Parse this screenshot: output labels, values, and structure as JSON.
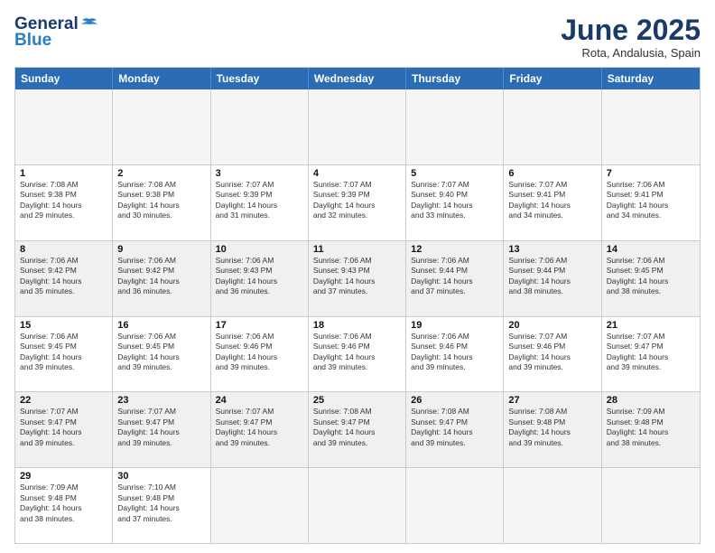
{
  "logo": {
    "line1": "General",
    "line2": "Blue"
  },
  "title": "June 2025",
  "subtitle": "Rota, Andalusia, Spain",
  "header_days": [
    "Sunday",
    "Monday",
    "Tuesday",
    "Wednesday",
    "Thursday",
    "Friday",
    "Saturday"
  ],
  "rows": [
    [
      {
        "day": "",
        "info": "",
        "empty": true
      },
      {
        "day": "",
        "info": "",
        "empty": true
      },
      {
        "day": "",
        "info": "",
        "empty": true
      },
      {
        "day": "",
        "info": "",
        "empty": true
      },
      {
        "day": "",
        "info": "",
        "empty": true
      },
      {
        "day": "",
        "info": "",
        "empty": true
      },
      {
        "day": "",
        "info": "",
        "empty": true
      }
    ],
    [
      {
        "day": "1",
        "info": "Sunrise: 7:08 AM\nSunset: 9:38 PM\nDaylight: 14 hours\nand 29 minutes."
      },
      {
        "day": "2",
        "info": "Sunrise: 7:08 AM\nSunset: 9:38 PM\nDaylight: 14 hours\nand 30 minutes."
      },
      {
        "day": "3",
        "info": "Sunrise: 7:07 AM\nSunset: 9:39 PM\nDaylight: 14 hours\nand 31 minutes."
      },
      {
        "day": "4",
        "info": "Sunrise: 7:07 AM\nSunset: 9:39 PM\nDaylight: 14 hours\nand 32 minutes."
      },
      {
        "day": "5",
        "info": "Sunrise: 7:07 AM\nSunset: 9:40 PM\nDaylight: 14 hours\nand 33 minutes."
      },
      {
        "day": "6",
        "info": "Sunrise: 7:07 AM\nSunset: 9:41 PM\nDaylight: 14 hours\nand 34 minutes."
      },
      {
        "day": "7",
        "info": "Sunrise: 7:06 AM\nSunset: 9:41 PM\nDaylight: 14 hours\nand 34 minutes."
      }
    ],
    [
      {
        "day": "8",
        "info": "Sunrise: 7:06 AM\nSunset: 9:42 PM\nDaylight: 14 hours\nand 35 minutes."
      },
      {
        "day": "9",
        "info": "Sunrise: 7:06 AM\nSunset: 9:42 PM\nDaylight: 14 hours\nand 36 minutes."
      },
      {
        "day": "10",
        "info": "Sunrise: 7:06 AM\nSunset: 9:43 PM\nDaylight: 14 hours\nand 36 minutes."
      },
      {
        "day": "11",
        "info": "Sunrise: 7:06 AM\nSunset: 9:43 PM\nDaylight: 14 hours\nand 37 minutes."
      },
      {
        "day": "12",
        "info": "Sunrise: 7:06 AM\nSunset: 9:44 PM\nDaylight: 14 hours\nand 37 minutes."
      },
      {
        "day": "13",
        "info": "Sunrise: 7:06 AM\nSunset: 9:44 PM\nDaylight: 14 hours\nand 38 minutes."
      },
      {
        "day": "14",
        "info": "Sunrise: 7:06 AM\nSunset: 9:45 PM\nDaylight: 14 hours\nand 38 minutes."
      }
    ],
    [
      {
        "day": "15",
        "info": "Sunrise: 7:06 AM\nSunset: 9:45 PM\nDaylight: 14 hours\nand 39 minutes."
      },
      {
        "day": "16",
        "info": "Sunrise: 7:06 AM\nSunset: 9:45 PM\nDaylight: 14 hours\nand 39 minutes."
      },
      {
        "day": "17",
        "info": "Sunrise: 7:06 AM\nSunset: 9:46 PM\nDaylight: 14 hours\nand 39 minutes."
      },
      {
        "day": "18",
        "info": "Sunrise: 7:06 AM\nSunset: 9:46 PM\nDaylight: 14 hours\nand 39 minutes."
      },
      {
        "day": "19",
        "info": "Sunrise: 7:06 AM\nSunset: 9:46 PM\nDaylight: 14 hours\nand 39 minutes."
      },
      {
        "day": "20",
        "info": "Sunrise: 7:07 AM\nSunset: 9:46 PM\nDaylight: 14 hours\nand 39 minutes."
      },
      {
        "day": "21",
        "info": "Sunrise: 7:07 AM\nSunset: 9:47 PM\nDaylight: 14 hours\nand 39 minutes."
      }
    ],
    [
      {
        "day": "22",
        "info": "Sunrise: 7:07 AM\nSunset: 9:47 PM\nDaylight: 14 hours\nand 39 minutes."
      },
      {
        "day": "23",
        "info": "Sunrise: 7:07 AM\nSunset: 9:47 PM\nDaylight: 14 hours\nand 39 minutes."
      },
      {
        "day": "24",
        "info": "Sunrise: 7:07 AM\nSunset: 9:47 PM\nDaylight: 14 hours\nand 39 minutes."
      },
      {
        "day": "25",
        "info": "Sunrise: 7:08 AM\nSunset: 9:47 PM\nDaylight: 14 hours\nand 39 minutes."
      },
      {
        "day": "26",
        "info": "Sunrise: 7:08 AM\nSunset: 9:47 PM\nDaylight: 14 hours\nand 39 minutes."
      },
      {
        "day": "27",
        "info": "Sunrise: 7:08 AM\nSunset: 9:48 PM\nDaylight: 14 hours\nand 39 minutes."
      },
      {
        "day": "28",
        "info": "Sunrise: 7:09 AM\nSunset: 9:48 PM\nDaylight: 14 hours\nand 38 minutes."
      }
    ],
    [
      {
        "day": "29",
        "info": "Sunrise: 7:09 AM\nSunset: 9:48 PM\nDaylight: 14 hours\nand 38 minutes."
      },
      {
        "day": "30",
        "info": "Sunrise: 7:10 AM\nSunset: 9:48 PM\nDaylight: 14 hours\nand 37 minutes."
      },
      {
        "day": "",
        "info": "",
        "empty": true
      },
      {
        "day": "",
        "info": "",
        "empty": true
      },
      {
        "day": "",
        "info": "",
        "empty": true
      },
      {
        "day": "",
        "info": "",
        "empty": true
      },
      {
        "day": "",
        "info": "",
        "empty": true
      }
    ]
  ]
}
